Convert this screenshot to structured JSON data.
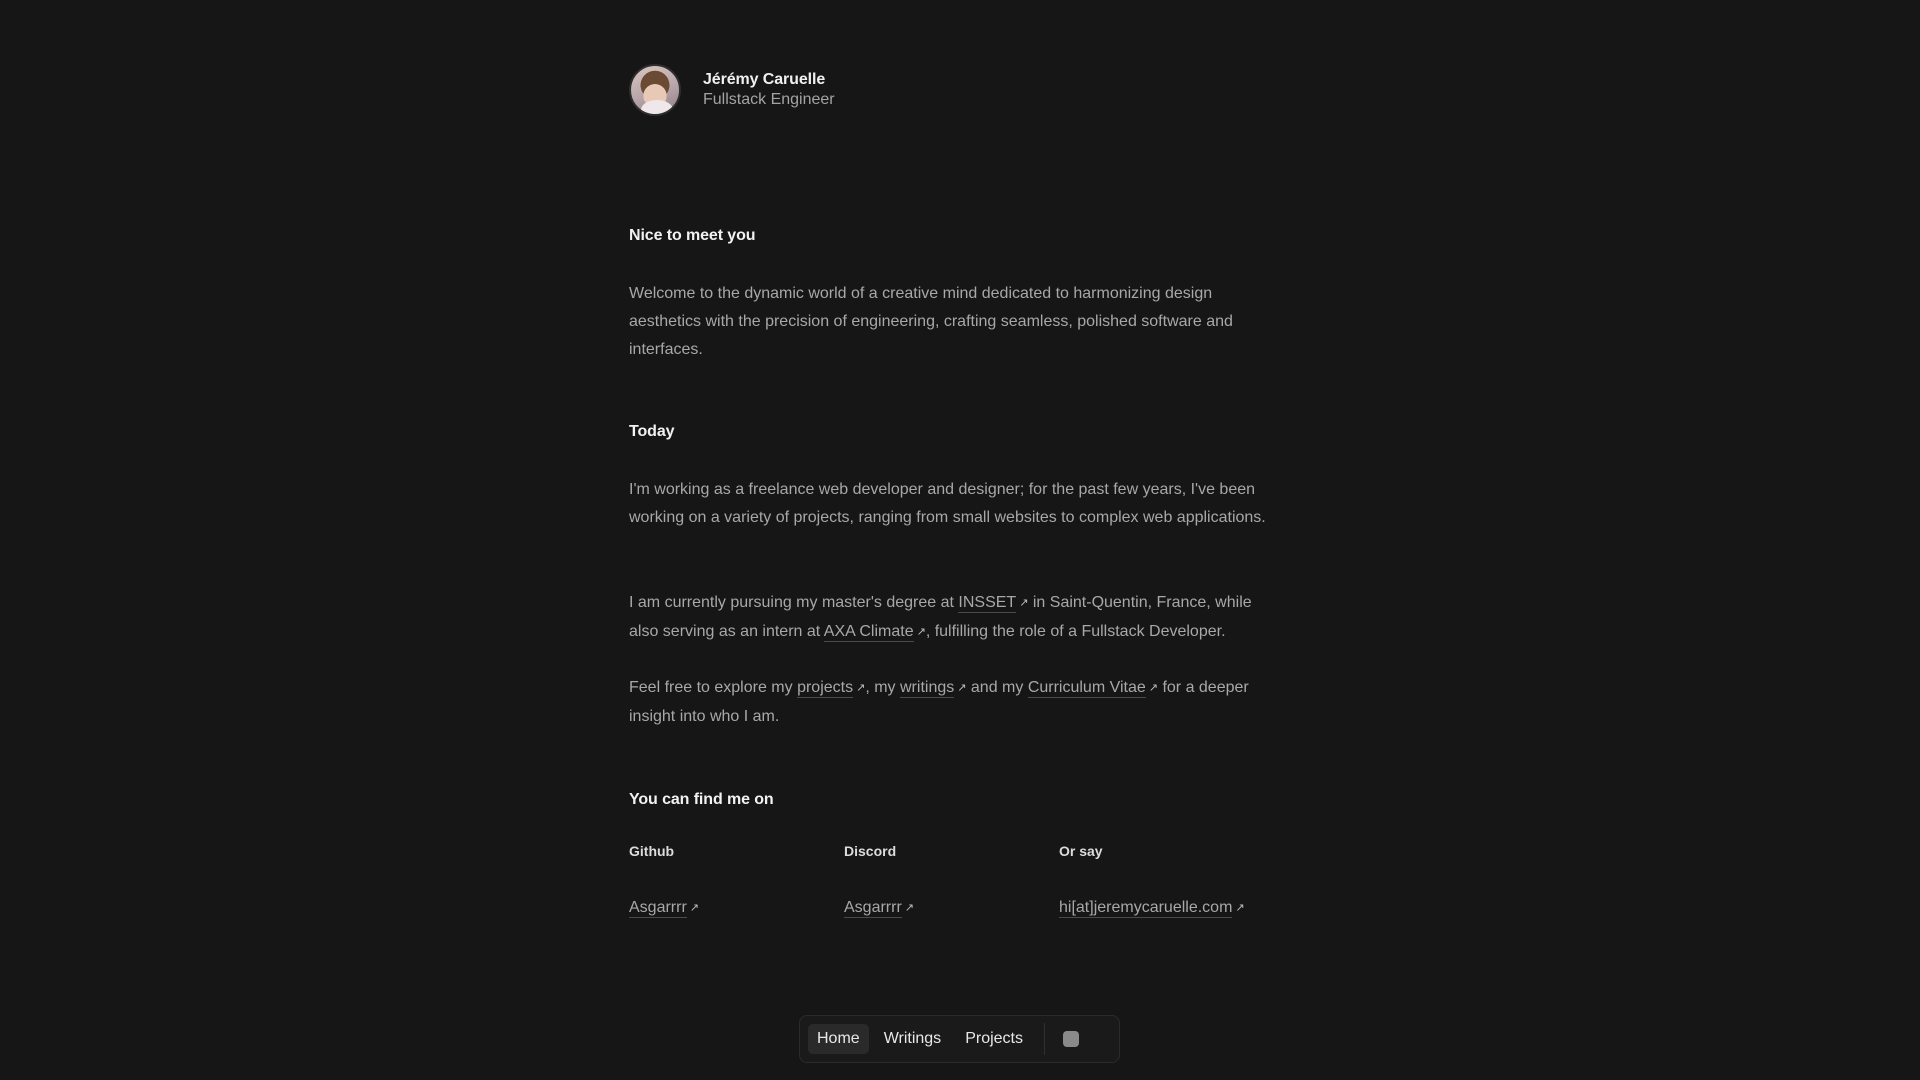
{
  "profile": {
    "name": "Jérémy Caruelle",
    "role": "Fullstack Engineer"
  },
  "intro": {
    "heading": "Nice to meet you",
    "text": "Welcome to the dynamic world of a creative mind dedicated to harmonizing design aesthetics with the precision of engineering, crafting seamless, polished software and interfaces."
  },
  "today": {
    "heading": "Today",
    "para1": "I'm working as a freelance web developer and designer; for the past few years, I've been working on a variety of projects, ranging from small websites to complex web applications.",
    "para2": {
      "t1": "I am currently pursuing my master's degree at ",
      "link1": "INSSET",
      "t2": " in Saint-Quentin, France, while also serving as an intern at ",
      "link2": "AXA Climate",
      "t3": ", fulfilling the role of a Fullstack Developer."
    },
    "para3": {
      "t1": "Feel free to explore my ",
      "link1": "projects",
      "t2": ", my ",
      "link2": "writings",
      "t3": " and my ",
      "link3": "Curriculum Vitae",
      "t4": "  for a deeper insight into who I am."
    }
  },
  "find": {
    "heading": "You can find me on",
    "columns": [
      {
        "label": "Github",
        "link": "Asgarrrr"
      },
      {
        "label": "Discord",
        "link": "Asgarrrr"
      },
      {
        "label": "Or say",
        "link": "hi[at]jeremycaruelle.com"
      }
    ]
  },
  "nav": {
    "items": [
      "Home",
      "Writings",
      "Projects"
    ],
    "active": "Home",
    "toggle_icon": "theme-toggle-icon"
  },
  "arrow_glyph": "↗"
}
